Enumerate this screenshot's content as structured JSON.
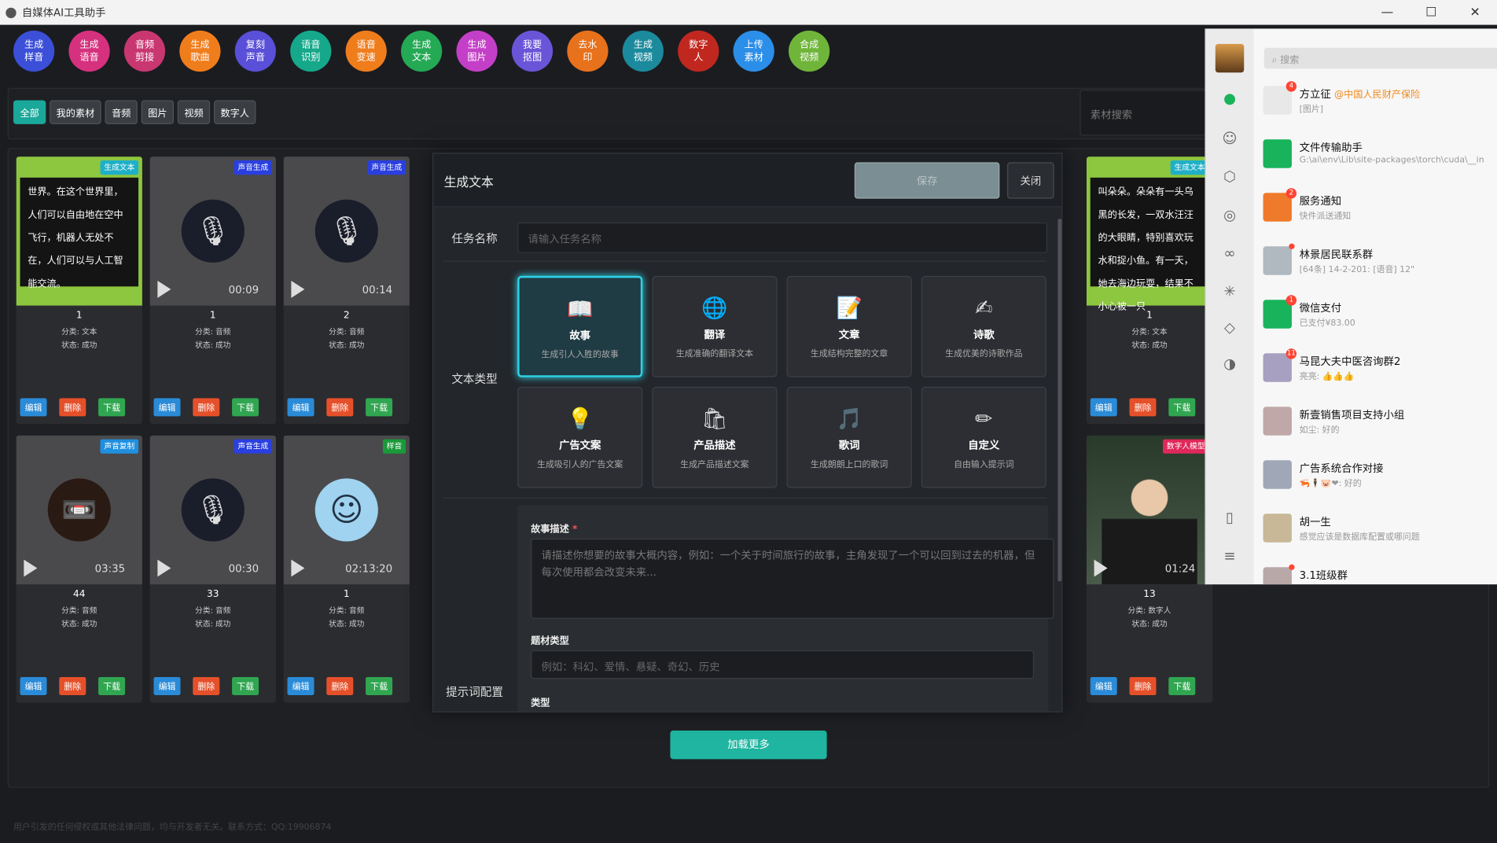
{
  "window": {
    "title": "自媒体AI工具助手",
    "min": "—",
    "max": "☐",
    "close": "✕"
  },
  "toolbar": [
    {
      "label": "生成样音",
      "color": "#3b4fd8"
    },
    {
      "label": "生成语音",
      "color": "#d6317e"
    },
    {
      "label": "音频剪接",
      "color": "#c93770"
    },
    {
      "label": "生成歌曲",
      "color": "#f07d1c"
    },
    {
      "label": "复刻声音",
      "color": "#5a4fd8"
    },
    {
      "label": "语音识别",
      "color": "#16a88a"
    },
    {
      "label": "语音变速",
      "color": "#f07d1c"
    },
    {
      "label": "生成文本",
      "color": "#24a955"
    },
    {
      "label": "生成图片",
      "color": "#c43fc7"
    },
    {
      "label": "我要抠图",
      "color": "#6a55d8"
    },
    {
      "label": "去水印",
      "color": "#e8711c"
    },
    {
      "label": "生成视频",
      "color": "#1b8a9c"
    },
    {
      "label": "数字人",
      "color": "#c0281f"
    },
    {
      "label": "上传素材",
      "color": "#2b8ee8"
    },
    {
      "label": "合成视频",
      "color": "#6fb53a"
    }
  ],
  "filters": {
    "tabs": [
      "全部",
      "我的素材",
      "音频",
      "图片",
      "视频",
      "数字人"
    ],
    "active": "全部",
    "search_placeholder": "素材搜索"
  },
  "cards": [
    {
      "kind": "text",
      "badge": "生成文本",
      "badge_color": "#1fb0c8",
      "preview": "世界。在这个世界里，人们可以自由地在空中飞行，机器人无处不在，人们可以与人工智能交流。",
      "num": "1",
      "cat": "分类: 文本",
      "status": "状态: 成功"
    },
    {
      "kind": "mic",
      "badge": "声音生成",
      "badge_color": "#2a3fe0",
      "dur": "00:09",
      "num": "1",
      "cat": "分类: 音频",
      "status": "状态: 成功"
    },
    {
      "kind": "mic",
      "badge": "声音生成",
      "badge_color": "#2a3fe0",
      "dur": "00:14",
      "num": "2",
      "cat": "分类: 音频",
      "status": "状态: 成功"
    },
    {
      "kind": "text",
      "badge": "生成文本",
      "badge_color": "#1fb0c8",
      "preview": "叫朵朵。朵朵有一头乌黑的长发，一双水汪汪的大眼睛，特别喜欢玩水和捉小鱼。有一天，她去海边玩耍，结果不小心被一只",
      "num": "1",
      "cat": "分类: 文本",
      "status": "状态: 成功"
    },
    {
      "kind": "cassette",
      "badge": "声音复制",
      "badge_color": "#1f8fe0",
      "dur": "03:35",
      "num": "44",
      "cat": "分类: 音频",
      "status": "状态: 成功"
    },
    {
      "kind": "mic",
      "badge": "声音生成",
      "badge_color": "#2a3fe0",
      "dur": "00:30",
      "num": "33",
      "cat": "分类: 音频",
      "status": "状态: 成功"
    },
    {
      "kind": "avatar",
      "badge": "样音",
      "badge_color": "#1a9a3a",
      "dur": "02:13:20",
      "num": "1",
      "cat": "分类: 音频",
      "status": "状态: 成功"
    },
    {
      "kind": "person",
      "badge": "数字人模型",
      "badge_color": "#e0285a",
      "dur": "01:24",
      "num": "13",
      "cat": "分类: 数字人",
      "status": "状态: 成功"
    }
  ],
  "card_buttons": {
    "edit": "编辑",
    "delete": "删除",
    "download": "下载"
  },
  "load_more": "加载更多",
  "footer": "用户引发的任何侵权或其他法律问题，均与开发者无关。联系方式：QQ:19906874",
  "modal": {
    "title": "生成文本",
    "save": "保存",
    "close": "关闭",
    "task_label": "任务名称",
    "task_placeholder": "请输入任务名称",
    "type_label": "文本类型",
    "types": [
      {
        "icon": "📖",
        "title": "故事",
        "desc": "生成引人入胜的故事"
      },
      {
        "icon": "🌐",
        "title": "翻译",
        "desc": "生成准确的翻译文本"
      },
      {
        "icon": "📝",
        "title": "文章",
        "desc": "生成结构完整的文章"
      },
      {
        "icon": "✍",
        "title": "诗歌",
        "desc": "生成优美的诗歌作品"
      },
      {
        "icon": "💡",
        "title": "广告文案",
        "desc": "生成吸引人的广告文案"
      },
      {
        "icon": "🛍",
        "title": "产品描述",
        "desc": "生成产品描述文案"
      },
      {
        "icon": "🎵",
        "title": "歌词",
        "desc": "生成朗朗上口的歌词"
      },
      {
        "icon": "✏",
        "title": "自定义",
        "desc": "自由输入提示词"
      }
    ],
    "active_type": "故事",
    "prompt_label": "提示词配置",
    "story_label": "故事描述",
    "required_mark": "*",
    "story_placeholder": "请描述你想要的故事大概内容，例如：一个关于时间旅行的故事，主角发现了一个可以回到过去的机器，但每次使用都会改变未来...",
    "genre_label": "题材类型",
    "genre_placeholder": "例如：科幻、爱情、悬疑、奇幻、历史",
    "kind_label": "类型"
  },
  "wechat": {
    "search_placeholder": "搜索",
    "chats": [
      {
        "name": "方立征",
        "org": "@中国人民财产保险",
        "sub": "[图片]",
        "badge": "4",
        "color": "#e8e8e8"
      },
      {
        "name": "文件传输助手",
        "org": "",
        "sub": "G:\\ai\\env\\Lib\\site-packages\\torch\\cuda\\__in",
        "badge": "",
        "color": "#19b35c"
      },
      {
        "name": "服务通知",
        "org": "",
        "sub": "快件派送通知",
        "badge": "2",
        "color": "#f07a2c"
      },
      {
        "name": "林景居民联系群",
        "org": "",
        "sub": "[64条] 14-2-201: [语音] 12\"",
        "badge": "dot",
        "color": "#b0b8c0"
      },
      {
        "name": "微信支付",
        "org": "",
        "sub": "已支付¥83.00",
        "badge": "1",
        "color": "#19b35c"
      },
      {
        "name": "马昆大夫中医咨询群2",
        "org": "",
        "sub": "亮亮: 👍👍👍",
        "badge": "11",
        "color": "#a8a0c0"
      },
      {
        "name": "新壹销售项目支持小组",
        "org": "",
        "sub": "如尘: 好的",
        "badge": "",
        "color": "#c0a8a8"
      },
      {
        "name": "广告系统合作对接",
        "org": "",
        "sub": "🦐🕴🐷❤: 好的",
        "badge": "",
        "color": "#a0a8b8"
      },
      {
        "name": "胡一生",
        "org": "",
        "sub": "感觉应该是数据库配置或哪问题",
        "badge": "",
        "color": "#c8b898"
      },
      {
        "name": "3.1班级群",
        "org": "",
        "sub": "",
        "badge": "dot",
        "color": "#b8a8a8"
      }
    ]
  }
}
